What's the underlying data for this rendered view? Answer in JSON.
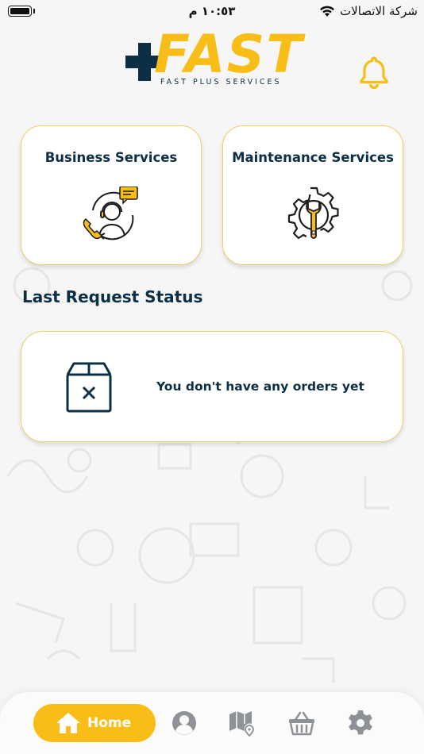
{
  "status_bar": {
    "time": "١٠:٥٣ م",
    "carrier": "شركة الاتصالات"
  },
  "header": {
    "logo_word": "FAST",
    "logo_subtitle": "FAST PLUS SERVICES"
  },
  "services": [
    {
      "label": "Business Services",
      "icon": "customer-support-icon"
    },
    {
      "label": "Maintenance Services",
      "icon": "wrench-gear-icon"
    }
  ],
  "last_request": {
    "title": "Last Request Status",
    "empty_message": "You don't have any orders yet",
    "icon": "empty-box-icon"
  },
  "bottom_nav": {
    "home_label": "Home",
    "items": [
      "home-icon",
      "profile-icon",
      "map-icon",
      "basket-icon",
      "settings-icon"
    ]
  },
  "colors": {
    "brand_yellow": "#f8bd17",
    "brand_navy": "#0d2f45",
    "card_border": "#f0cf6b",
    "icon_gray": "#8e9297"
  }
}
